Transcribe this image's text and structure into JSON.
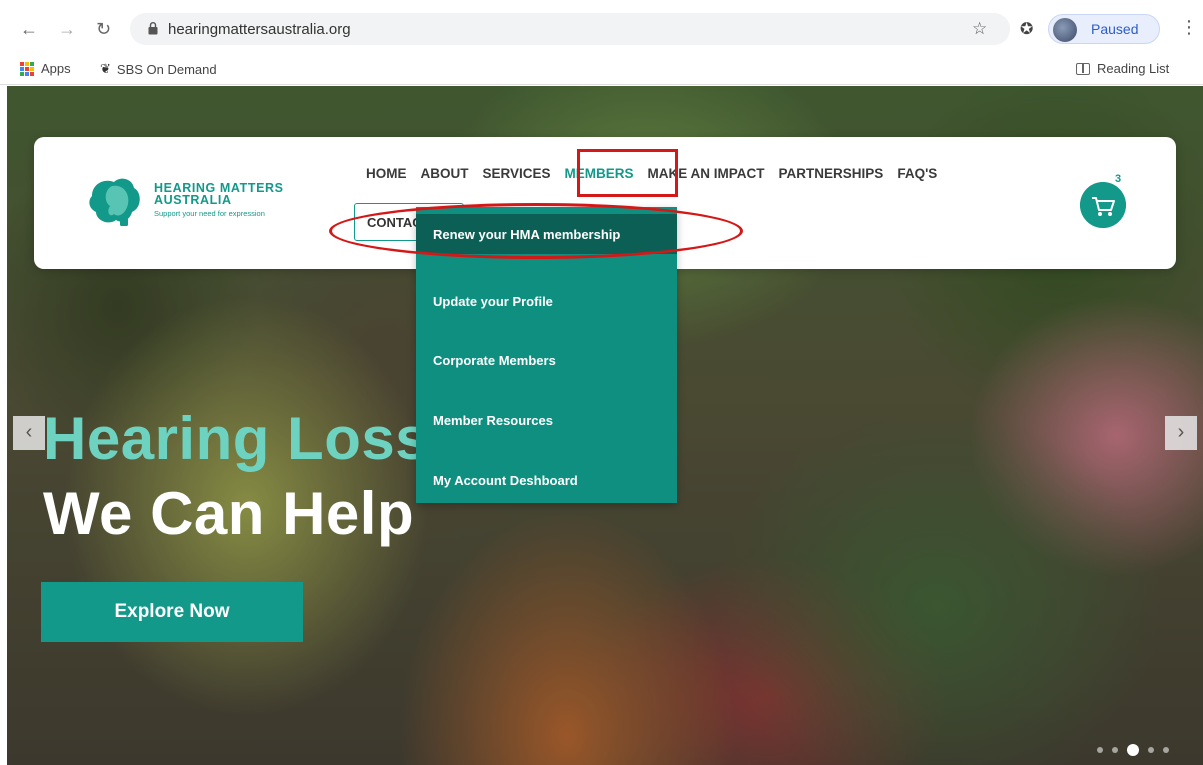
{
  "browser": {
    "url": "hearingmattersaustralia.org",
    "profile_status": "Paused",
    "bookmarks": {
      "apps": "Apps",
      "sbs": "SBS On Demand",
      "reading_list": "Reading List"
    }
  },
  "site": {
    "logo": {
      "line1": "HEARING MATTERS",
      "line2": "AUSTRALIA",
      "tagline": "Support your need for expression"
    },
    "nav": [
      "HOME",
      "ABOUT",
      "SERVICES",
      "MEMBERS",
      "MAKE AN IMPACT",
      "PARTNERSHIPS",
      "FAQ'S"
    ],
    "contact_label": "CONTACT",
    "cart_count": "3",
    "members_menu": [
      "Renew your HMA membership",
      "Update your Profile",
      "Corporate Members",
      "Member Resources",
      "My Account Deshboard"
    ]
  },
  "hero": {
    "line1": "Hearing Loss?",
    "line2": "We Can Help",
    "cta": "Explore Now"
  },
  "colors": {
    "brand_teal": "#12998a",
    "dropdown_bg": "#0f8f80",
    "dropdown_active": "#0c5f55",
    "hero_accent": "#6dd3c0",
    "annotation_red": "#d41818"
  },
  "icons": [
    "back-arrow-icon",
    "forward-arrow-icon",
    "reload-icon",
    "lock-icon",
    "star-icon",
    "puzzle-icon",
    "cart-icon",
    "chevron-left-icon",
    "chevron-right-icon"
  ]
}
